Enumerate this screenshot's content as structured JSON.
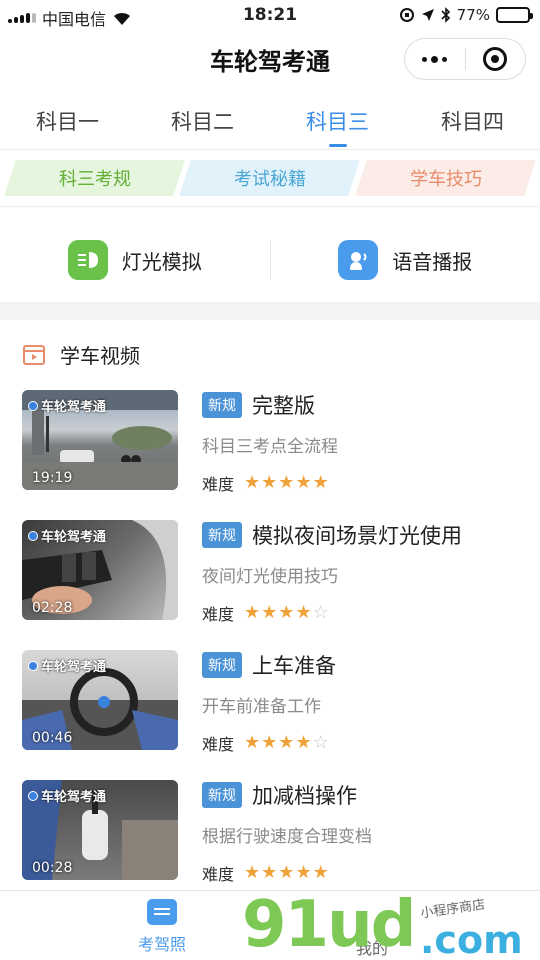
{
  "status": {
    "carrier": "中国电信",
    "time": "18:21",
    "battery": "77%",
    "battery_level": 0.77
  },
  "header": {
    "title": "车轮驾考通"
  },
  "tabs": [
    {
      "label": "科目一",
      "active": false
    },
    {
      "label": "科目二",
      "active": false
    },
    {
      "label": "科目三",
      "active": true
    },
    {
      "label": "科目四",
      "active": false
    }
  ],
  "categories": [
    "科三考规",
    "考试秘籍",
    "学车技巧"
  ],
  "tools": [
    {
      "label": "灯光模拟",
      "icon": "headlight-icon",
      "color": "#6cc14a"
    },
    {
      "label": "语音播报",
      "icon": "voice-icon",
      "color": "#4a9bec"
    }
  ],
  "section": {
    "title": "学车视频"
  },
  "videos": [
    {
      "logo": "车轮驾考通",
      "duration": "19:19",
      "badge": "新规",
      "title": "完整版",
      "desc": "科目三考点全流程",
      "difficulty_label": "难度",
      "stars": 5
    },
    {
      "logo": "车轮驾考通",
      "duration": "02:28",
      "badge": "新规",
      "title": "模拟夜间场景灯光使用",
      "desc": "夜间灯光使用技巧",
      "difficulty_label": "难度",
      "stars": 4
    },
    {
      "logo": "车轮驾考通",
      "duration": "00:46",
      "badge": "新规",
      "title": "上车准备",
      "desc": "开车前准备工作",
      "difficulty_label": "难度",
      "stars": 4
    },
    {
      "logo": "车轮驾考通",
      "duration": "00:28",
      "badge": "新规",
      "title": "加减档操作",
      "desc": "根据行驶速度合理变档",
      "difficulty_label": "难度",
      "stars": 5
    }
  ],
  "bottom_nav": [
    {
      "label": "考驾照",
      "active": true
    },
    {
      "label": "我的",
      "active": false
    }
  ],
  "watermark": {
    "main": "91ud",
    "domain": ".com",
    "tag": "小程序商店"
  }
}
